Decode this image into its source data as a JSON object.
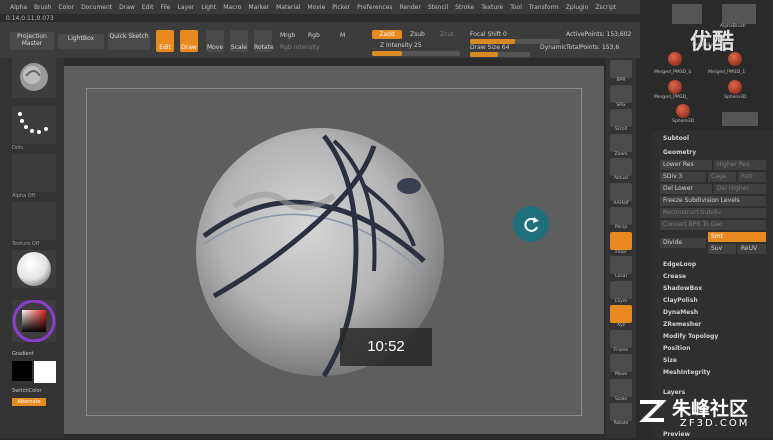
{
  "menu": [
    "Alpha",
    "Brush",
    "Color",
    "Document",
    "Draw",
    "Edit",
    "File",
    "Layer",
    "Light",
    "Macro",
    "Marker",
    "Material",
    "Movie",
    "Picker",
    "Preferences",
    "Render",
    "Stencil",
    "Stroke",
    "Texture",
    "Tool",
    "Transform",
    "Zplugin",
    "Zscript"
  ],
  "coords": "0.14,0.11,0.073",
  "toolbar": {
    "projection_master": "Projection Master",
    "lightbox": "LightBox",
    "quick_sketch": "Quick Sketch",
    "edit": "Edit",
    "draw": "Draw",
    "move": "Move",
    "scale": "Scale",
    "rotate": "Rotate",
    "mrgb": "Mrgb",
    "rgb": "Rgb",
    "m": "M",
    "rgb_intensity": "Rgb Intensity",
    "zadd": "Zadd",
    "zsub": "Zsub",
    "zcut": "Zcut",
    "z_intensity": "Z Intensity 25",
    "focal_shift": "Focal Shift 0",
    "draw_size": "Draw Size 64",
    "dynamic": "Dynamic",
    "active_points": "ActivePoints: 153,602",
    "total_points": "TotalPoints: 153,6"
  },
  "left_panel": {
    "labels": [
      "",
      "Dots",
      "Alpha Off",
      "Texture Off",
      "",
      ""
    ],
    "gradient": "Gradient",
    "switch_color": "SwitchColor",
    "alternate": "Alternate"
  },
  "shelf": [
    "BPR",
    "SPix",
    "Scroll",
    "Zoom",
    "Actual",
    "AAHalf",
    "Persp",
    "Floor",
    "Local",
    "LSym",
    "Xyz",
    "Frame",
    "Move",
    "Scale",
    "Rotate"
  ],
  "right_panel": {
    "tools": [
      "AlphaBrush",
      "SimpleBrush",
      "Merged_PM3D_S",
      "Merged_PM3D_1",
      "Merged_PM3D_",
      "Sphere3D",
      "Merged_PM3D_",
      "Sphere3D",
      "Sphere3D",
      "Merged_PM3D"
    ],
    "subtool": "Subtool",
    "geometry": "Geometry",
    "lower_res": "Lower Res",
    "higher_res": "Higher Res",
    "sdiv": "SDiv 3",
    "cage": "Cage",
    "rstr": "Rstr",
    "del_lower": "Del Lower",
    "del_higher": "Del Higher",
    "freeze_subdivision": "Freeze Subdivision Levels",
    "reconstruct_subdiv": "Reconstruct Subdiv",
    "convert_bpr": "Convert BPR To Geo",
    "divide": "Divide",
    "smt": "Smt",
    "suv": "Suv",
    "reuv": "ReUV",
    "items": [
      "EdgeLoop",
      "Crease",
      "ShadowBox",
      "ClayPolish",
      "DynaMesh",
      "ZRemesher",
      "Modify Topology",
      "Position",
      "Size",
      "MeshIntegrity"
    ],
    "layers": "Layers",
    "preview": "Preview"
  },
  "overlay": {
    "timestamp": "10:52",
    "watermark_top": "优酷",
    "watermark_brand": "朱峰社区",
    "watermark_site": "ZF3D.COM"
  },
  "colors": {
    "accent": "#e88a1f",
    "canvas": "#5e5e5e",
    "rotate_button": "#1f6f7c"
  }
}
